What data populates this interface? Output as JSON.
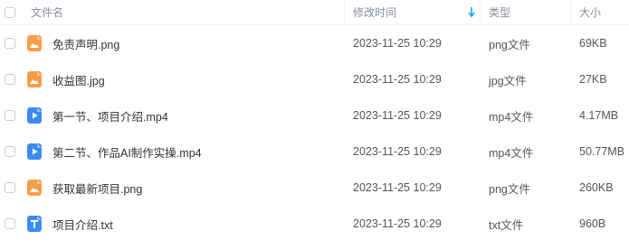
{
  "header": {
    "name": "文件名",
    "modified": "修改时间",
    "type": "类型",
    "size": "大小"
  },
  "files": [
    {
      "name": "免责声明.png",
      "modified": "2023-11-25 10:29",
      "type": "png文件",
      "size": "69KB",
      "icon": "image-file-icon",
      "color": "#f79d4a"
    },
    {
      "name": "收益图.jpg",
      "modified": "2023-11-25 10:29",
      "type": "jpg文件",
      "size": "27KB",
      "icon": "image-file-icon",
      "color": "#f79d4a"
    },
    {
      "name": "第一节、项目介绍.mp4",
      "modified": "2023-11-25 10:29",
      "type": "mp4文件",
      "size": "4.17MB",
      "icon": "video-file-icon",
      "color": "#3d8af7"
    },
    {
      "name": "第二节、作品AI制作实操.mp4",
      "modified": "2023-11-25 10:29",
      "type": "mp4文件",
      "size": "50.77MB",
      "icon": "video-file-icon",
      "color": "#3d8af7"
    },
    {
      "name": "获取最新项目.png",
      "modified": "2023-11-25 10:29",
      "type": "png文件",
      "size": "260KB",
      "icon": "image-file-icon",
      "color": "#f79d4a"
    },
    {
      "name": "项目介绍.txt",
      "modified": "2023-11-25 10:29",
      "type": "txt文件",
      "size": "960B",
      "icon": "text-file-icon",
      "color": "#3d8af7"
    }
  ],
  "accent": "#06a7ff"
}
